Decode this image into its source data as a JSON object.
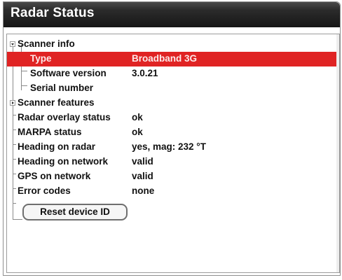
{
  "window": {
    "title": "Radar Status"
  },
  "tree": {
    "rows": [
      {
        "label": "Scanner info",
        "value": ""
      },
      {
        "label": "Type",
        "value": "Broadband 3G"
      },
      {
        "label": "Software version",
        "value": "3.0.21"
      },
      {
        "label": "Serial number",
        "value": ""
      },
      {
        "label": "Scanner features",
        "value": ""
      },
      {
        "label": "Radar overlay status",
        "value": "ok"
      },
      {
        "label": "MARPA status",
        "value": "ok"
      },
      {
        "label": "Heading on radar",
        "value": "yes, mag: 232 °T"
      },
      {
        "label": "Heading on network",
        "value": "valid"
      },
      {
        "label": "GPS on network",
        "value": "valid"
      },
      {
        "label": "Error codes",
        "value": "none"
      }
    ]
  },
  "actions": {
    "reset_label": "Reset device ID"
  },
  "colors": {
    "selected_row": "#e02323",
    "title_bar": "#1e1e1e"
  },
  "icons": {
    "expanded": "triangle-down-icon",
    "collapsed": "triangle-right-icon"
  }
}
